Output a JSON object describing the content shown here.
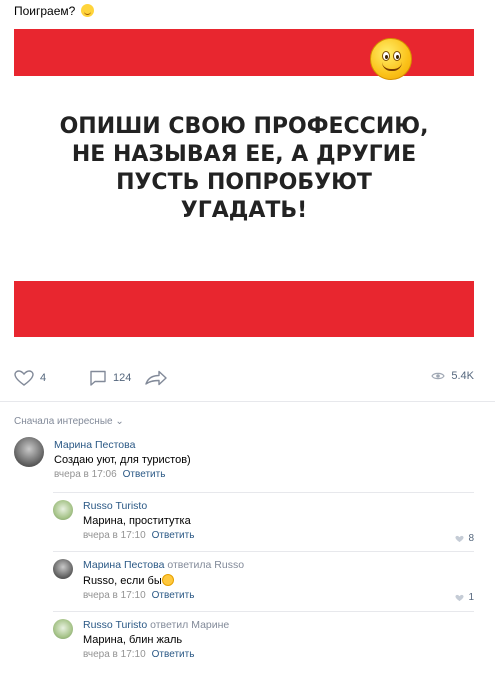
{
  "post": {
    "text": "Поиграем?",
    "image": {
      "headline_lines": [
        "ОПИШИ СВОЮ ПРОФЕССИЮ,",
        "НЕ НАЗЫВАЯ ЕЕ, А ДРУГИЕ",
        "ПУСТЬ ПОПРОБУЮТ",
        "УГАДАТЬ!"
      ],
      "band_color": "#e8262f",
      "emoji": "smiley-face"
    },
    "actions": {
      "likes": "4",
      "comments": "124",
      "views": "5.4K"
    }
  },
  "comments_sort": "Сначала интересные",
  "comments": [
    {
      "author": "Марина Пестова",
      "reply_to": "",
      "text": "Создаю уют, для туристов)",
      "time": "вчера в 17:06",
      "reply_label": "Ответить",
      "likes": ""
    },
    {
      "author": "Russo Turisto",
      "reply_to": "",
      "text": "Марина, проститутка",
      "time": "вчера в 17:10",
      "reply_label": "Ответить",
      "likes": "8"
    },
    {
      "author": "Марина Пестова",
      "reply_to": "ответила Russo",
      "text": "Russo, если бы",
      "time": "вчера в 17:10",
      "reply_label": "Ответить",
      "likes": "1"
    },
    {
      "author": "Russo Turisto",
      "reply_to": "ответил Марине",
      "text": "Марина, блин жаль",
      "time": "вчера в 17:10",
      "reply_label": "Ответить",
      "likes": ""
    }
  ],
  "colors": {
    "link": "#2a5885",
    "muted": "#828a99",
    "accent_red": "#e8262f"
  }
}
